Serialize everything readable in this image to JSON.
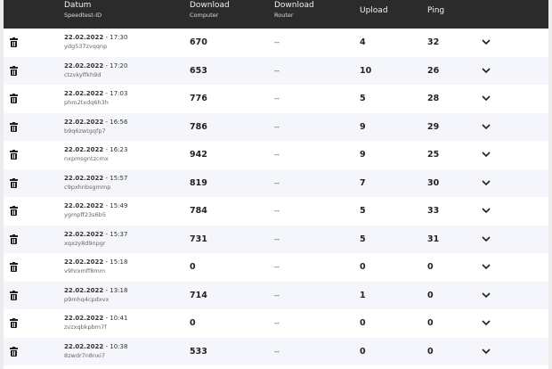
{
  "header": {
    "date_label": "Datum",
    "date_sub": "Speedtest-ID",
    "download_label": "Download",
    "download_sub": "Computer",
    "router_label": "Download",
    "router_sub": "Router",
    "upload_label": "Upload",
    "ping_label": "Ping"
  },
  "rows": [
    {
      "date": "22.02.2022",
      "time": " - 17:30",
      "id": "ydg537zvqqnp",
      "download": "670",
      "router": "--",
      "upload": "4",
      "ping": "32"
    },
    {
      "date": "22.02.2022",
      "time": " - 17:20",
      "id": "ctzvkyffkh9d",
      "download": "653",
      "router": "--",
      "upload": "10",
      "ping": "26"
    },
    {
      "date": "22.02.2022",
      "time": " - 17:03",
      "id": "phm2txdq6h3h",
      "download": "776",
      "router": "--",
      "upload": "5",
      "ping": "28"
    },
    {
      "date": "22.02.2022",
      "time": " - 16:56",
      "id": "b9q6zwtgqfp7",
      "download": "786",
      "router": "--",
      "upload": "9",
      "ping": "29"
    },
    {
      "date": "22.02.2022",
      "time": " - 16:23",
      "id": "nxpmsgntzcmx",
      "download": "942",
      "router": "--",
      "upload": "9",
      "ping": "25"
    },
    {
      "date": "22.02.2022",
      "time": " - 15:57",
      "id": "c9pxhnbsgmmp",
      "download": "819",
      "router": "--",
      "upload": "7",
      "ping": "30"
    },
    {
      "date": "22.02.2022",
      "time": " - 15:49",
      "id": "ygmpff23s6b5",
      "download": "784",
      "router": "--",
      "upload": "5",
      "ping": "33"
    },
    {
      "date": "22.02.2022",
      "time": " - 15:37",
      "id": "xqxzy8d9npgr",
      "download": "731",
      "router": "--",
      "upload": "5",
      "ping": "31"
    },
    {
      "date": "22.02.2022",
      "time": " - 15:18",
      "id": "v9hrxmff8mm",
      "download": "0",
      "router": "--",
      "upload": "0",
      "ping": "0"
    },
    {
      "date": "22.02.2022",
      "time": " - 13:18",
      "id": "p9mhq4cpdxvx",
      "download": "714",
      "router": "--",
      "upload": "1",
      "ping": "0"
    },
    {
      "date": "22.02.2022",
      "time": " - 10:41",
      "id": "zvzxqbkpbm7f",
      "download": "0",
      "router": "--",
      "upload": "0",
      "ping": "0"
    },
    {
      "date": "22.02.2022",
      "time": " - 10:38",
      "id": "8zwdr7n8nxi7",
      "download": "533",
      "router": "--",
      "upload": "0",
      "ping": "0"
    }
  ],
  "icons": {
    "delete": "trash-icon",
    "expand": "chevron-down-icon"
  },
  "colors": {
    "header_bg": "#2b2b2b",
    "row_alt_bg": "#f4f6fb",
    "text": "#222222"
  }
}
